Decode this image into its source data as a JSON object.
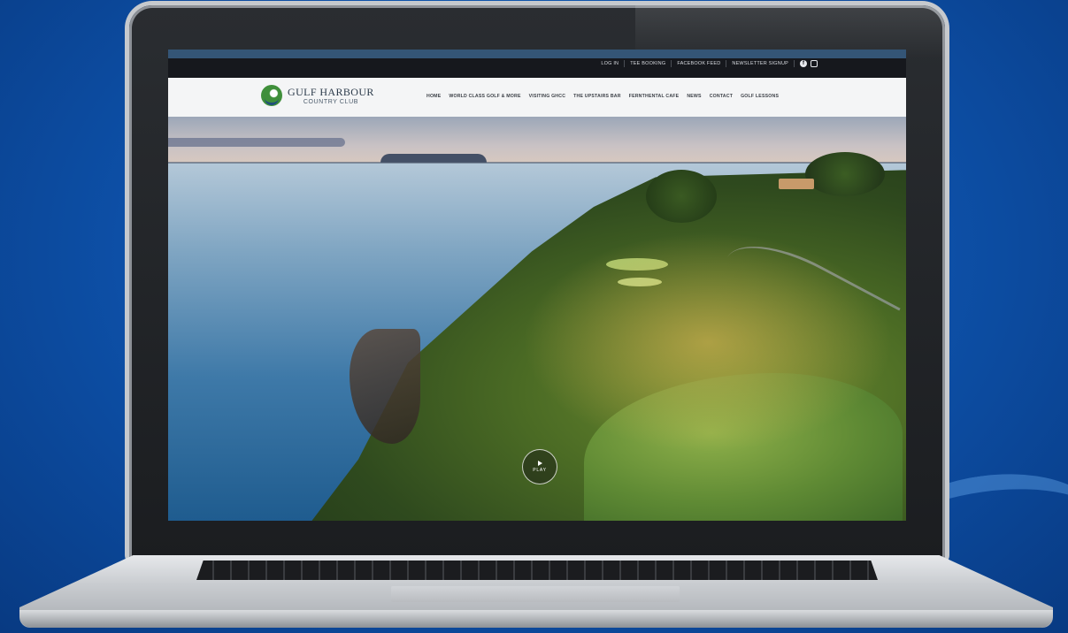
{
  "topbar": {
    "links": [
      "LOG IN",
      "TEE BOOKING",
      "FACEBOOK FEED",
      "NEWSLETTER SIGNUP"
    ],
    "social_icons": [
      "facebook-icon",
      "instagram-icon"
    ]
  },
  "brand": {
    "title": "GULF HARBOUR",
    "subtitle": "COUNTRY CLUB"
  },
  "nav": {
    "items": [
      "HOME",
      "WORLD CLASS GOLF & MORE",
      "VISITING GHCC",
      "THE UPSTAIRS BAR",
      "FERNTHENTAL CAFE",
      "NEWS",
      "CONTACT",
      "GOLF LESSONS"
    ]
  },
  "hero": {
    "play_label": "PLAY"
  },
  "colors": {
    "background": "#0d4fa6",
    "topbar": "#16181d",
    "navbar": "#f4f5f6",
    "brand_green": "#3f8f3a"
  }
}
